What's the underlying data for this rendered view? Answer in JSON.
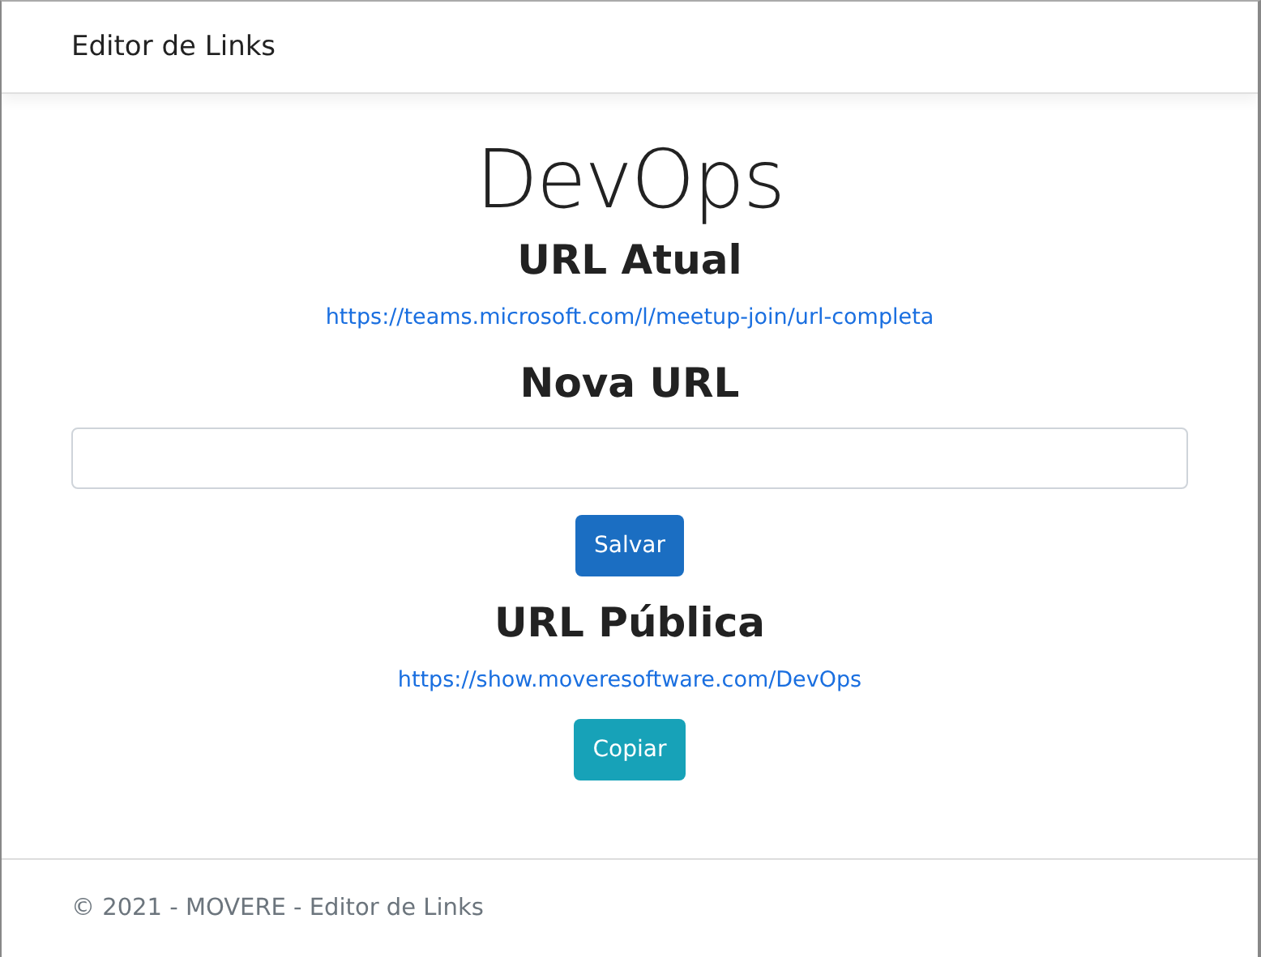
{
  "navbar": {
    "brand": "Editor de Links"
  },
  "title": "DevOps",
  "sections": [
    {
      "heading": "URL Atual",
      "kind": "link",
      "link": "https://teams.microsoft.com/l/meetup-join/url-completa"
    },
    {
      "heading": "Nova URL",
      "kind": "input",
      "button": {
        "label": "Salvar",
        "kind": "primary"
      }
    },
    {
      "heading": "URL Pública",
      "kind": "link",
      "link": "https://show.moveresoftware.com/DevOps",
      "button": {
        "label": "Copiar",
        "kind": "info"
      }
    }
  ],
  "footer": "© 2021 - MOVERE - Editor de Links"
}
